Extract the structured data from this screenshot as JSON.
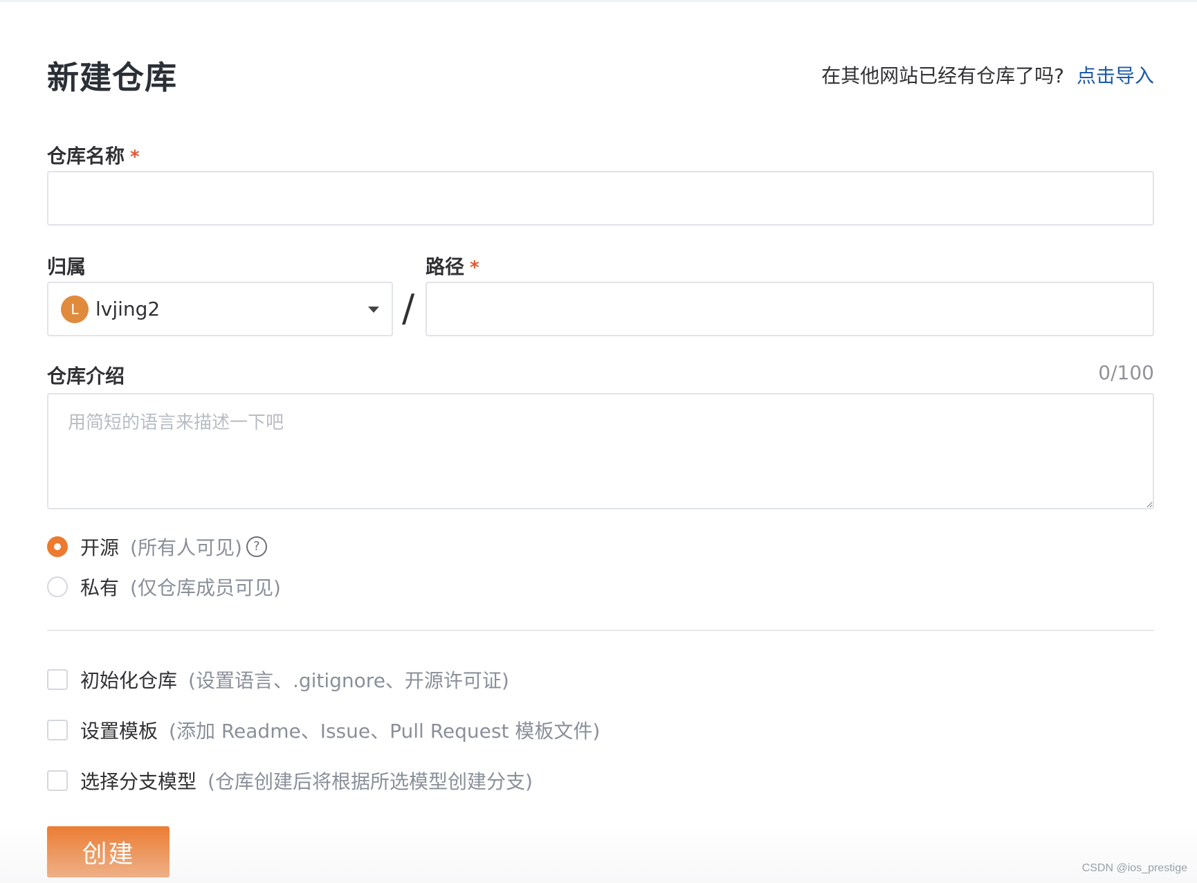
{
  "header": {
    "title": "新建仓库",
    "import_prompt": "在其他网站已经有仓库了吗?",
    "import_link": "点击导入"
  },
  "form": {
    "repo_name": {
      "label": "仓库名称",
      "required_mark": "*",
      "value": ""
    },
    "owner": {
      "label": "归属",
      "avatar_letter": "L",
      "value": "lvjing2"
    },
    "separator": "/",
    "path": {
      "label": "路径",
      "required_mark": "*",
      "value": ""
    },
    "description": {
      "label": "仓库介绍",
      "counter": "0/100",
      "placeholder": "用简短的语言来描述一下吧",
      "value": ""
    },
    "visibility": {
      "options": [
        {
          "label": "开源",
          "hint": "(所有人可见)",
          "selected": true
        },
        {
          "label": "私有",
          "hint": "(仅仓库成员可见)",
          "selected": false
        }
      ],
      "help_glyph": "?"
    },
    "options": [
      {
        "label": "初始化仓库",
        "hint": "(设置语言、.gitignore、开源许可证)",
        "checked": false
      },
      {
        "label": "设置模板",
        "hint": "(添加 Readme、Issue、Pull Request 模板文件)",
        "checked": false
      },
      {
        "label": "选择分支模型",
        "hint": "(仓库创建后将根据所选模型创建分支)",
        "checked": false
      }
    ],
    "submit_label": "创建"
  },
  "colors": {
    "accent": "#ec7a2f",
    "link": "#1c5aa6",
    "required": "#e4572e"
  },
  "watermark": "CSDN @ios_prestige"
}
